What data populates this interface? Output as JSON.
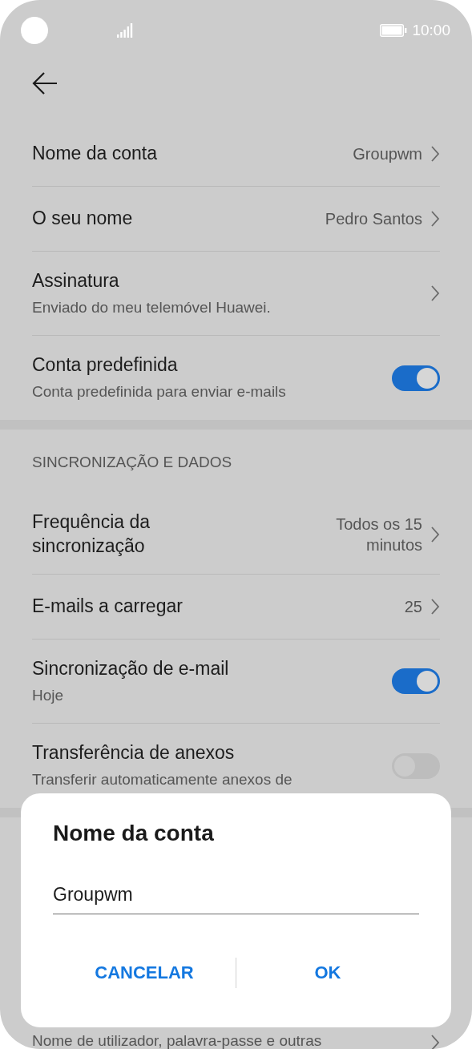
{
  "status_bar": {
    "time": "10:00"
  },
  "settings": [
    {
      "items": [
        {
          "kind": "value",
          "title": "Nome da conta",
          "value": "Groupwm"
        },
        {
          "kind": "value",
          "title": "O seu nome",
          "value": "Pedro Santos"
        },
        {
          "kind": "link",
          "title": "Assinatura",
          "subtitle": "Enviado do meu telemóvel Huawei."
        },
        {
          "kind": "toggle",
          "title": "Conta predefinida",
          "subtitle": "Conta predefinida para enviar e-mails",
          "on": true
        }
      ]
    },
    {
      "header": "SINCRONIZAÇÃO E DADOS",
      "items": [
        {
          "kind": "value",
          "title": "Frequência da sincronização",
          "value": "Todos os 15 minutos"
        },
        {
          "kind": "value",
          "title": "E-mails a carregar",
          "value": "25"
        },
        {
          "kind": "toggle",
          "title": "Sincronização de e-mail",
          "subtitle": "Hoje",
          "on": true
        },
        {
          "kind": "toggle",
          "title": "Transferência de anexos",
          "subtitle": "Transferir automaticamente anexos de",
          "on": false
        }
      ]
    },
    {
      "items": [
        {
          "kind": "link",
          "subtitle": "Nome de utilizador, palavra-passe e outras"
        }
      ]
    }
  ],
  "dialog": {
    "title": "Nome da conta",
    "value": "Groupwm",
    "buttons": [
      "CANCELAR",
      "OK"
    ]
  }
}
